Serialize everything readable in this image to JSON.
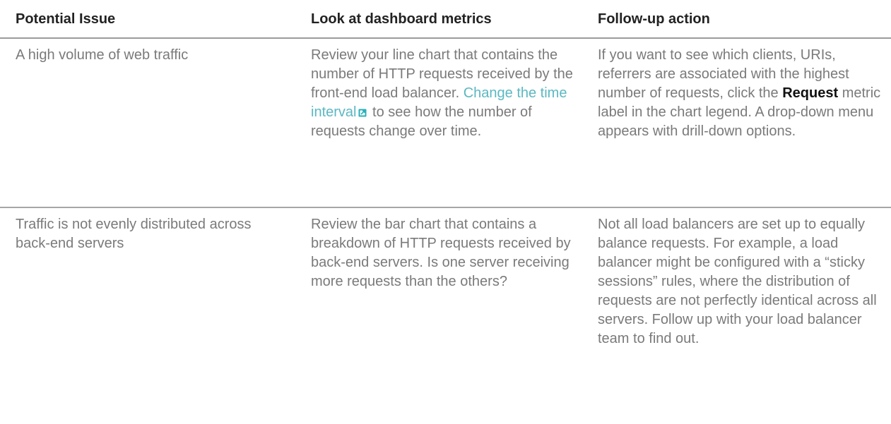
{
  "table": {
    "headers": [
      "Potential Issue",
      "Look at dashboard metrics",
      "Follow-up action"
    ],
    "rows": [
      {
        "issue": "A high volume of web traffic",
        "metrics": {
          "before": "Review your line chart that contains the number of HTTP requests received by the front-end load balancer. ",
          "link_text": "Change the time interval",
          "link_icon": "external-link-icon",
          "after": " to see how the number of requests change over time."
        },
        "action": {
          "before": "If you want to see which clients, URIs, referrers are associated with the highest number of requests, click the ",
          "bold": "Request",
          "after": " metric label in the chart legend. A drop-down menu appears with drill-down options."
        }
      },
      {
        "issue": "Traffic is not evenly distributed across back-end servers",
        "metrics": "Review the bar chart that contains a breakdown of HTTP requests received by back-end servers. Is one server receiving more requests than the others?",
        "action": "Not all load balancers are set up to equally balance requests. For example, a load balancer might be configured with a “sticky sessions” rules, where the distribution of requests are not perfectly identical across all servers. Follow up with your load balancer team to find out."
      }
    ]
  },
  "colors": {
    "header_text": "#222222",
    "body_text": "#7a7a7a",
    "link": "#5bb8c2",
    "icon": "#2bb0b8",
    "rule": "#9b9b9b"
  }
}
